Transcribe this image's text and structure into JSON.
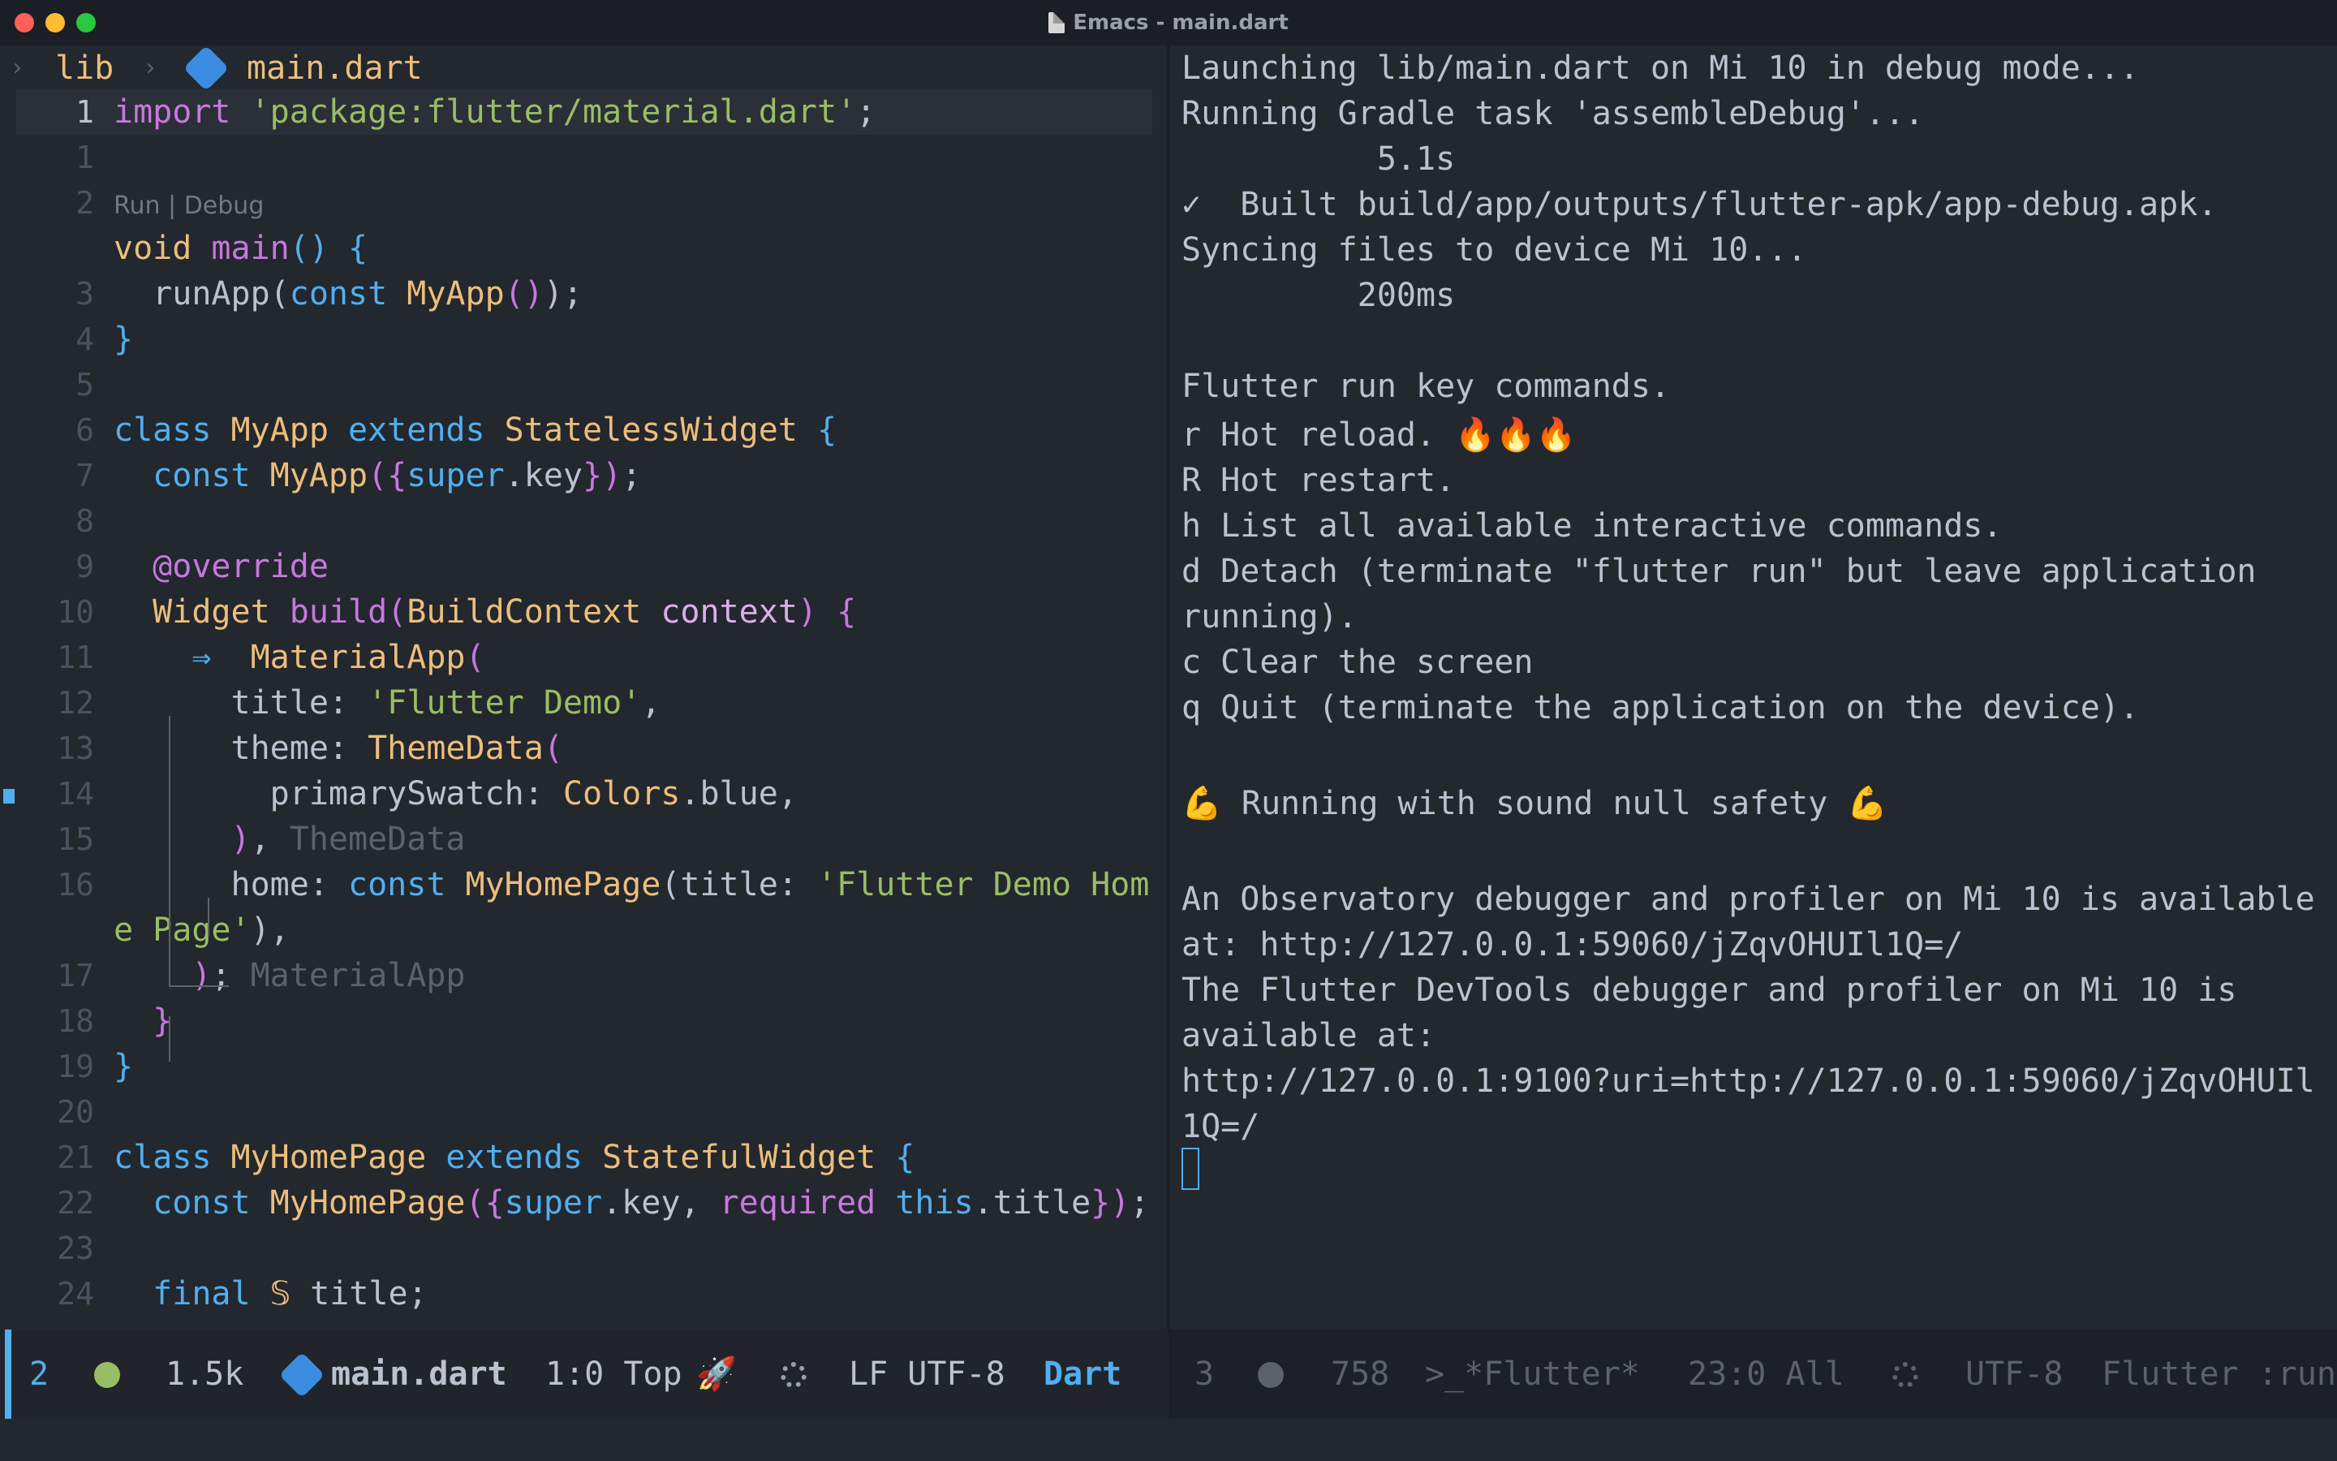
{
  "window": {
    "title": "Emacs - main.dart"
  },
  "breadcrumb": {
    "folder": "lib",
    "file": "main.dart",
    "chevron": "›"
  },
  "editor": {
    "codelens": "Run | Debug",
    "lines": [
      {
        "n": "1",
        "code": [
          [
            "import ",
            "kw"
          ],
          [
            "'package:flutter/material.dart'",
            "str"
          ],
          [
            ";",
            "pl"
          ]
        ]
      },
      {
        "n": "1",
        "code": []
      },
      {
        "n": "2",
        "code": []
      },
      {
        "n": "",
        "code": [
          [
            "void ",
            "ty"
          ],
          [
            "main",
            "fn"
          ],
          [
            "() {",
            "bl"
          ]
        ]
      },
      {
        "n": "3",
        "code": [
          [
            "  runApp(",
            "pl"
          ],
          [
            "const ",
            "kw2"
          ],
          [
            "MyApp",
            "ty"
          ],
          [
            "()",
            "pu"
          ],
          [
            ");",
            "pl"
          ]
        ]
      },
      {
        "n": "4",
        "code": [
          [
            "}",
            "bl"
          ]
        ]
      },
      {
        "n": "5",
        "code": []
      },
      {
        "n": "6",
        "code": [
          [
            "class ",
            "kw2"
          ],
          [
            "MyApp ",
            "ty"
          ],
          [
            "extends ",
            "kw2"
          ],
          [
            "StatelessWidget ",
            "ty"
          ],
          [
            "{",
            "bl"
          ]
        ]
      },
      {
        "n": "7",
        "code": [
          [
            "  ",
            "pl"
          ],
          [
            "const ",
            "kw2"
          ],
          [
            "MyApp",
            "ty"
          ],
          [
            "({",
            "pu"
          ],
          [
            "super",
            "kw2"
          ],
          [
            ".key",
            "pl"
          ],
          [
            "})",
            "pu"
          ],
          [
            ";",
            "pl"
          ]
        ]
      },
      {
        "n": "8",
        "code": []
      },
      {
        "n": "9",
        "code": [
          [
            "  @override",
            "an"
          ]
        ]
      },
      {
        "n": "10",
        "code": [
          [
            "  ",
            "pl"
          ],
          [
            "Widget ",
            "ty"
          ],
          [
            "build",
            "fn"
          ],
          [
            "(",
            "pu"
          ],
          [
            "BuildContext ",
            "ty"
          ],
          [
            "context",
            "var"
          ],
          [
            ") ",
            "pu"
          ],
          [
            "{",
            "pu"
          ]
        ]
      },
      {
        "n": "11",
        "code": [
          [
            "    ",
            "pl"
          ],
          [
            "⇒ ",
            "bl"
          ],
          [
            " MaterialApp",
            "ty"
          ],
          [
            "(",
            "pu"
          ]
        ]
      },
      {
        "n": "12",
        "code": [
          [
            "      title: ",
            "pl"
          ],
          [
            "'Flutter Demo'",
            "str"
          ],
          [
            ",",
            "pl"
          ]
        ]
      },
      {
        "n": "13",
        "code": [
          [
            "      theme: ",
            "pl"
          ],
          [
            "ThemeData",
            "ty"
          ],
          [
            "(",
            "pu"
          ]
        ]
      },
      {
        "n": "14",
        "code": [
          [
            "        primarySwatch: ",
            "pl"
          ],
          [
            "Colors",
            "ty"
          ],
          [
            ".blue,",
            "pl"
          ]
        ]
      },
      {
        "n": "15",
        "code": [
          [
            "      ",
            "pl"
          ],
          [
            ")",
            "pu"
          ],
          [
            ", ",
            "pl"
          ],
          [
            "ThemeData",
            "gr"
          ]
        ]
      },
      {
        "n": "16",
        "code": [
          [
            "      home: ",
            "pl"
          ],
          [
            "const ",
            "kw2"
          ],
          [
            "MyHomePage",
            "ty"
          ],
          [
            "(title: ",
            "pl"
          ],
          [
            "'Flutter Demo Hom",
            "str"
          ]
        ]
      },
      {
        "n": "",
        "code": [
          [
            "e Page'",
            "str"
          ],
          [
            "),",
            "pl"
          ]
        ]
      },
      {
        "n": "17",
        "code": [
          [
            "    ",
            "pl"
          ],
          [
            ")",
            "pu"
          ],
          [
            "; ",
            "pl"
          ],
          [
            "MaterialApp",
            "gr"
          ]
        ]
      },
      {
        "n": "18",
        "code": [
          [
            "  ",
            "pl"
          ],
          [
            "}",
            "pu"
          ]
        ]
      },
      {
        "n": "19",
        "code": [
          [
            "}",
            "bl"
          ]
        ]
      },
      {
        "n": "20",
        "code": []
      },
      {
        "n": "21",
        "code": [
          [
            "class ",
            "kw2"
          ],
          [
            "MyHomePage ",
            "ty"
          ],
          [
            "extends ",
            "kw2"
          ],
          [
            "StatefulWidget ",
            "ty"
          ],
          [
            "{",
            "bl"
          ]
        ]
      },
      {
        "n": "22",
        "code": [
          [
            "  ",
            "pl"
          ],
          [
            "const ",
            "kw2"
          ],
          [
            "MyHomePage",
            "ty"
          ],
          [
            "({",
            "pu"
          ],
          [
            "super",
            "kw2"
          ],
          [
            ".key, ",
            "pl"
          ],
          [
            "required ",
            "kw"
          ],
          [
            "this",
            "kw2"
          ],
          [
            ".title",
            "pl"
          ],
          [
            "})",
            "pu"
          ],
          [
            ";",
            "pl"
          ]
        ]
      },
      {
        "n": "23",
        "code": []
      },
      {
        "n": "24",
        "code": [
          [
            "  ",
            "pl"
          ],
          [
            "final ",
            "kw2"
          ],
          [
            "𝕊 ",
            "ty"
          ],
          [
            "title;",
            "pl"
          ]
        ]
      }
    ]
  },
  "terminal": {
    "lines": [
      "Launching lib/main.dart on Mi 10 in debug mode...",
      "Running Gradle task 'assembleDebug'...",
      "          5.1s",
      "✓  Built build/app/outputs/flutter-apk/app-debug.apk.",
      "Syncing files to device Mi 10...",
      "         200ms",
      "",
      "Flutter run key commands.",
      "r Hot reload. 🔥🔥🔥",
      "R Hot restart.",
      "h List all available interactive commands.",
      "d Detach (terminate \"flutter run\" but leave application",
      "running).",
      "c Clear the screen",
      "q Quit (terminate the application on the device).",
      "",
      "💪 Running with sound null safety 💪",
      "",
      "An Observatory debugger and profiler on Mi 10 is available",
      "at: http://127.0.0.1:59060/jZqvOHUIl1Q=/",
      "The Flutter DevTools debugger and profiler on Mi 10 is",
      "available at:",
      "http://127.0.0.1:9100?uri=http://127.0.0.1:59060/jZqvOHUIl",
      "1Q=/"
    ]
  },
  "modeline_left": {
    "window_num": "2",
    "size": "1.5k",
    "buffer": "main.dart",
    "position": "1:0 Top",
    "eol": "LF UTF-8",
    "mode": "Dart"
  },
  "modeline_right": {
    "window_num": "3",
    "size": "758",
    "buffer": ">_*Flutter*",
    "position": "23:0 All",
    "encoding": "UTF-8",
    "mode": "Flutter :run"
  },
  "colors": {
    "accent": "#51afef",
    "bg": "#23272e",
    "modeline": "#21252b"
  }
}
